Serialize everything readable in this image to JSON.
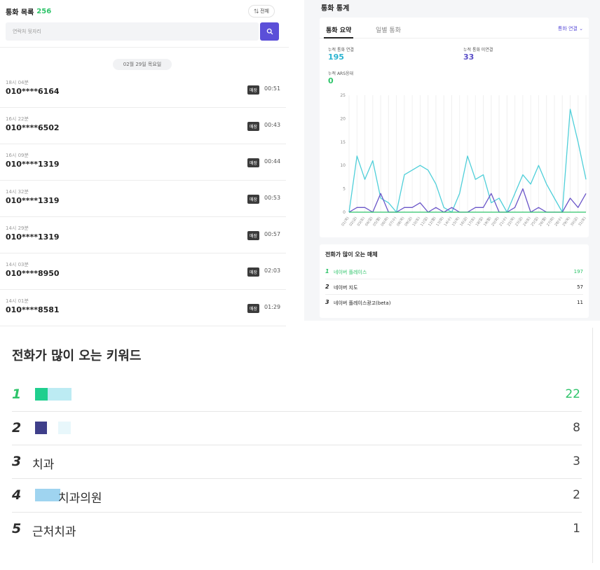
{
  "call_list": {
    "title": "통화 목록",
    "count": "256",
    "filter_label": "⇅ 전체",
    "search_placeholder": "연락처 뒷자리",
    "date_header": "02월 29일 목요일",
    "items": [
      {
        "time": "18시 04분",
        "number": "010****6164",
        "tag": "매장",
        "duration": "00:51"
      },
      {
        "time": "16시 22분",
        "number": "010****6502",
        "tag": "매장",
        "duration": "00:43"
      },
      {
        "time": "16시 09분",
        "number": "010****1319",
        "tag": "매장",
        "duration": "00:44"
      },
      {
        "time": "14시 32분",
        "number": "010****1319",
        "tag": "매장",
        "duration": "00:53"
      },
      {
        "time": "14시 29분",
        "number": "010****1319",
        "tag": "매장",
        "duration": "00:57"
      },
      {
        "time": "14시 03분",
        "number": "010****8950",
        "tag": "매장",
        "duration": "02:03"
      },
      {
        "time": "14시 01분",
        "number": "010****8581",
        "tag": "매장",
        "duration": "01:29"
      }
    ]
  },
  "stats": {
    "title": "통화 통계",
    "tabs": [
      "통화 요약",
      "일별 통화"
    ],
    "connection_select": "통화 연결",
    "metrics": [
      {
        "label": "누적 통화 연결",
        "value": "195",
        "color": "#2ab3d0"
      },
      {
        "label": "누적 통화 미연결",
        "value": "33",
        "color": "#5b4fc8"
      },
      {
        "label": "누적 ARS응대",
        "value": "0",
        "color": "#2ec46a"
      }
    ]
  },
  "chart_data": {
    "type": "line",
    "y_ticks": [
      "25",
      "20",
      "15",
      "10",
      "5",
      "0"
    ],
    "ylim": [
      0,
      25
    ],
    "x": [
      "01(목)",
      "02(금)",
      "03(토)",
      "04(일)",
      "05(월)",
      "06(화)",
      "07(수)",
      "08(목)",
      "09(금)",
      "10(토)",
      "11(일)",
      "12(월)",
      "13(화)",
      "14(수)",
      "15(목)",
      "16(금)",
      "17(토)",
      "18(일)",
      "19(월)",
      "20(화)",
      "21(수)",
      "22(목)",
      "23(금)",
      "24(토)",
      "25(일)",
      "26(월)",
      "27(화)",
      "28(수)",
      "29(목)",
      "30(금)",
      "31(토)"
    ],
    "series": [
      {
        "color": "#4fcfd9",
        "values": [
          0,
          12,
          7,
          11,
          3,
          2,
          0,
          8,
          9,
          10,
          9,
          6,
          1,
          0,
          4,
          12,
          7,
          8,
          2,
          3,
          0,
          4,
          8,
          6,
          10,
          6,
          3,
          0,
          22,
          15,
          7
        ]
      },
      {
        "color": "#6a55c8",
        "values": [
          0,
          1,
          1,
          0,
          4,
          0,
          0,
          1,
          1,
          2,
          0,
          1,
          0,
          1,
          0,
          0,
          1,
          1,
          4,
          0,
          0,
          1,
          5,
          0,
          1,
          0,
          0,
          0,
          3,
          1,
          4
        ]
      },
      {
        "color": "#2ec46a",
        "values": [
          0,
          0,
          0,
          0,
          0,
          0,
          0,
          0,
          0,
          0,
          0,
          0,
          0,
          0,
          0,
          0,
          0,
          0,
          0,
          0,
          0,
          0,
          0,
          0,
          0,
          0,
          0,
          0,
          0,
          0,
          0
        ]
      }
    ]
  },
  "media": {
    "title": "전화가 많이 오는 매체",
    "items": [
      {
        "rank": "1",
        "name": "네이버 플레이스",
        "count": "197",
        "color": "#2ec46a"
      },
      {
        "rank": "2",
        "name": "네이버 지도",
        "count": "57",
        "color": "#222222"
      },
      {
        "rank": "3",
        "name": "네이버 플레이스광고(beta)",
        "count": "11",
        "color": "#222222"
      }
    ]
  },
  "keywords": {
    "title": "전화가 많이 오는 키워드",
    "items": [
      {
        "rank": "1",
        "name": "",
        "count": "22",
        "color": "#2ec46a"
      },
      {
        "rank": "2",
        "name": "",
        "count": "8",
        "color": "#2c2c2c"
      },
      {
        "rank": "3",
        "name": "치과",
        "count": "3",
        "color": "#2c2c2c"
      },
      {
        "rank": "4",
        "name": "치과의원",
        "count": "2",
        "color": "#2c2c2c"
      },
      {
        "rank": "5",
        "name": "근처치과",
        "count": "1",
        "color": "#2c2c2c"
      }
    ]
  }
}
